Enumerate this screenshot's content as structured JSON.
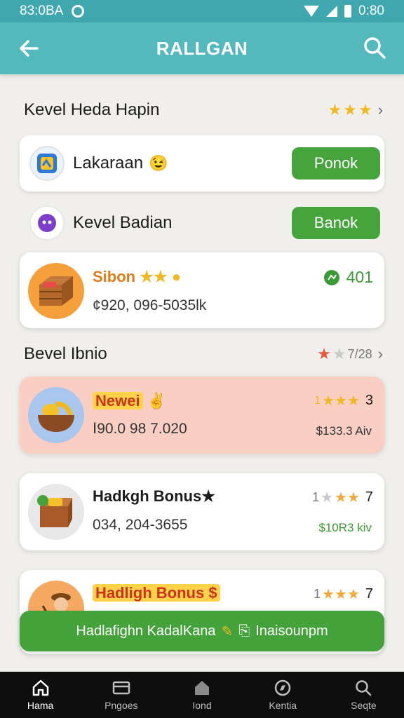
{
  "status": {
    "left_text": "83:0BA",
    "time": "0:80"
  },
  "app_bar": {
    "title": "RALLGAN"
  },
  "section1": {
    "title": "Kevel Heda Hapin"
  },
  "row1": {
    "label": "Lakaraan",
    "button": "Ponok",
    "emoji": "😉"
  },
  "row2": {
    "label": "Kevel Badian",
    "button": "Banok"
  },
  "card1": {
    "name": "Sibon",
    "sub": "¢920, 096-5035lk",
    "right_top": "401"
  },
  "section2": {
    "title": "Bevel Ibnio",
    "rating": "7/28"
  },
  "card2": {
    "name": "Newei",
    "sub": "Ⅰ90.0 98 7.020",
    "rating_prefix": "1",
    "rating_suffix": "3",
    "right_bottom": "$133.3 Aiv"
  },
  "card3": {
    "name": "Hadkgh Bonus★",
    "sub": "034, 204-3655",
    "rating_prefix": "1",
    "rating_suffix": "7",
    "right_bottom": "$10R3 kiv"
  },
  "card4": {
    "name": "Hadligh Bonus $",
    "rating_prefix": "1",
    "rating_suffix": "7"
  },
  "banner": {
    "text": "Hadlafighn KadalKana",
    "link": "Inaisounpm"
  },
  "nav": {
    "items": [
      "Hama",
      "Pngoes",
      "Iond",
      "Kentia",
      "Seqte"
    ]
  },
  "colors": {
    "teal": "#54b9bd",
    "green": "#45a43c",
    "pink": "#f9cfc3",
    "star": "#f0b823"
  }
}
